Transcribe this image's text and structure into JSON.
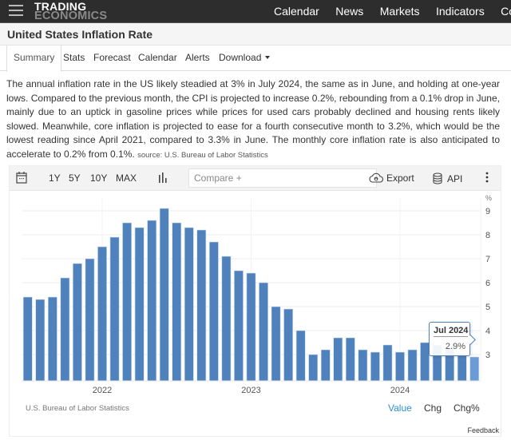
{
  "header": {
    "logo_line1": "TRADING",
    "logo_line2": "ECONOMICS",
    "nav": [
      "Calendar",
      "News",
      "Markets",
      "Indicators",
      "Countries"
    ]
  },
  "page": {
    "title": "United States Inflation Rate"
  },
  "tabs": [
    {
      "label": "Summary",
      "active": true
    },
    {
      "label": "Stats"
    },
    {
      "label": "Forecast"
    },
    {
      "label": "Calendar"
    },
    {
      "label": "Alerts"
    },
    {
      "label": "Download"
    }
  ],
  "summary": {
    "text": "The annual inflation rate in the US likely steadied at 3% in July 2024, the same as in June, and holding at one-year lows. Compared to the previous month, the CPI is projected to increase 0.2%, rebounding from a 0.1% drop in June, mainly due to an uptick in gasoline prices while prices for used cars probably declined and housing rents likely slowed. Meanwhile, core inflation is projected to ease for a fourth consecutive month to 3.2%, which would be the lowest reading since April 2021, compared to 3.3% in June. The monthly core inflation rate is also anticipated to accelerate to 0.2% from 0.1%.",
    "source": "source: U.S. Bureau of Labor Statistics"
  },
  "toolbar": {
    "ranges": [
      "1Y",
      "5Y",
      "10Y",
      "MAX"
    ],
    "compare_placeholder": "Compare +",
    "export_label": "Export",
    "api_label": "API"
  },
  "chart_footer": {
    "source": "U.S. Bureau of Labor Statistics",
    "toggles": [
      {
        "label": "Value",
        "active": true
      },
      {
        "label": "Chg"
      },
      {
        "label": "Chg%"
      }
    ],
    "feedback": "Feedback"
  },
  "tooltip": {
    "date": "Jul 2024",
    "value": "2.9%"
  },
  "colors": {
    "bar": "#4f81bd",
    "bar_highlight": "#6a9bd8",
    "active_toggle": "#2f8fd8"
  },
  "chart_data": {
    "type": "bar",
    "title": "United States Inflation Rate",
    "ylabel": "%",
    "xlabel": "",
    "ylim": [
      1.9,
      9.5
    ],
    "yticks": [
      3,
      4,
      5,
      6,
      7,
      8,
      9
    ],
    "x_tick_labels": [
      {
        "label": "2022",
        "index": 6
      },
      {
        "label": "2023",
        "index": 18
      },
      {
        "label": "2024",
        "index": 30
      }
    ],
    "grid": true,
    "categories": [
      "Jul 2021",
      "Aug 2021",
      "Sep 2021",
      "Oct 2021",
      "Nov 2021",
      "Dec 2021",
      "Jan 2022",
      "Feb 2022",
      "Mar 2022",
      "Apr 2022",
      "May 2022",
      "Jun 2022",
      "Jul 2022",
      "Aug 2022",
      "Sep 2022",
      "Oct 2022",
      "Nov 2022",
      "Dec 2022",
      "Jan 2023",
      "Feb 2023",
      "Mar 2023",
      "Apr 2023",
      "May 2023",
      "Jun 2023",
      "Jul 2023",
      "Aug 2023",
      "Sep 2023",
      "Oct 2023",
      "Nov 2023",
      "Dec 2023",
      "Jan 2024",
      "Feb 2024",
      "Mar 2024",
      "Apr 2024",
      "May 2024",
      "Jun 2024",
      "Jul 2024"
    ],
    "values": [
      5.4,
      5.3,
      5.4,
      6.2,
      6.8,
      7.0,
      7.5,
      7.9,
      8.5,
      8.3,
      8.6,
      9.1,
      8.5,
      8.3,
      8.2,
      7.7,
      7.1,
      6.5,
      6.4,
      6.0,
      5.0,
      4.9,
      4.0,
      3.0,
      3.2,
      3.7,
      3.7,
      3.2,
      3.1,
      3.4,
      3.1,
      3.2,
      3.5,
      3.4,
      3.3,
      3.0,
      2.9
    ],
    "highlighted_index": 36
  }
}
